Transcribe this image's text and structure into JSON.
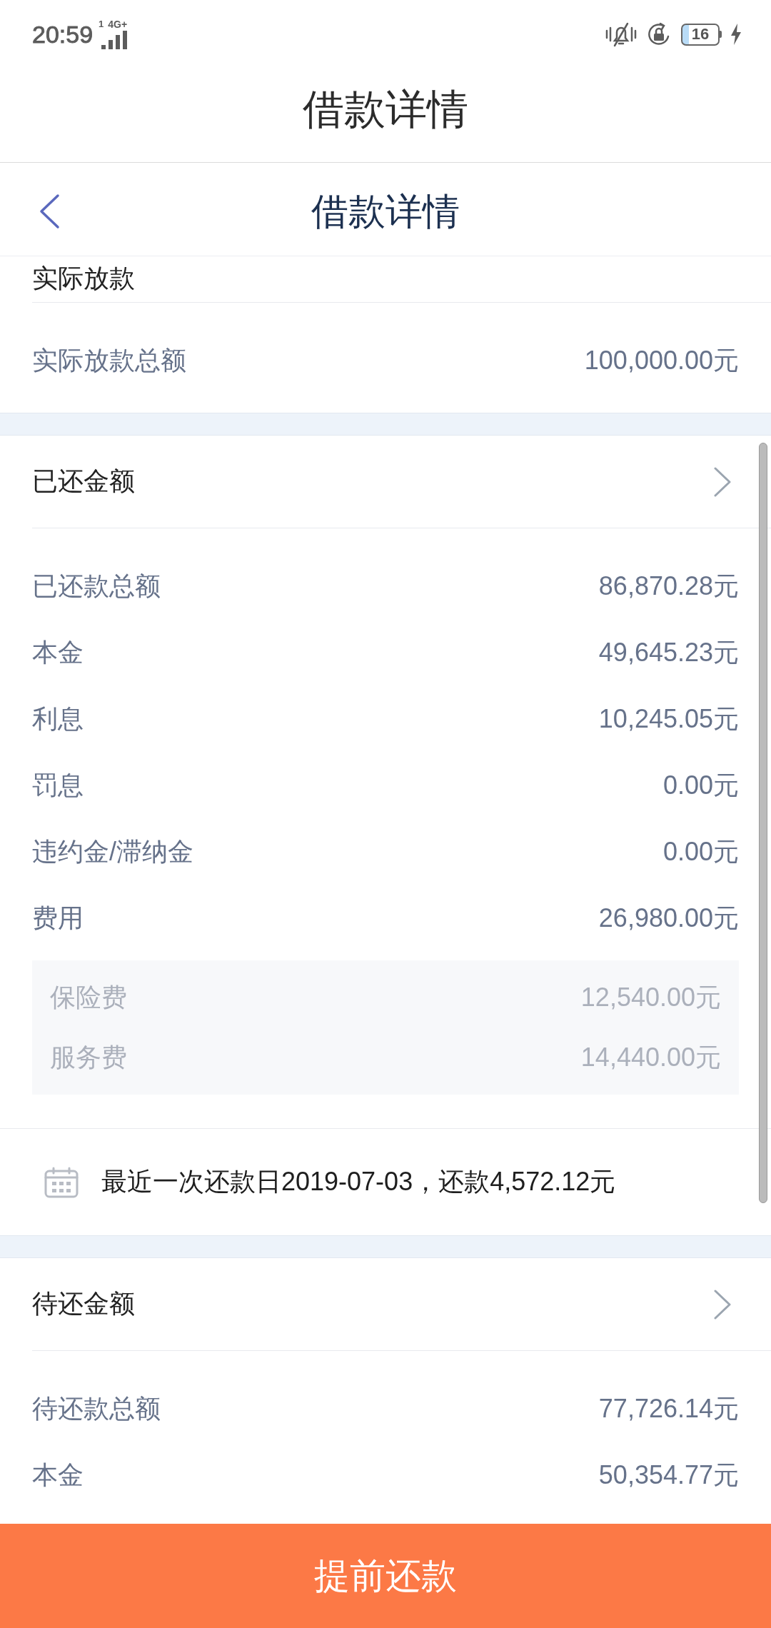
{
  "status_bar": {
    "time": "20:59",
    "sim": "1",
    "network": "4G+",
    "battery": "16"
  },
  "page_title": "借款详情",
  "nav_bar": {
    "title": "借款详情"
  },
  "sections": [
    {
      "heading": "实际放款",
      "chevron": false,
      "rows": [
        {
          "kind": "line",
          "label": "实际放款总额",
          "value": "100,000.00元"
        }
      ]
    },
    {
      "heading": "已还金额",
      "chevron": true,
      "rows": [
        {
          "kind": "line",
          "label": "已还款总额",
          "value": "86,870.28元"
        },
        {
          "kind": "line",
          "label": "本金",
          "value": "49,645.23元"
        },
        {
          "kind": "line",
          "label": "利息",
          "value": "10,245.05元"
        },
        {
          "kind": "line",
          "label": "罚息",
          "value": "0.00元"
        },
        {
          "kind": "line",
          "label": "违约金/滞纳金",
          "value": "0.00元"
        },
        {
          "kind": "line",
          "label": "费用",
          "value": "26,980.00元"
        },
        {
          "kind": "breakdown",
          "items": [
            {
              "label": "保险费",
              "value": "12,540.00元"
            },
            {
              "label": "服务费",
              "value": "14,440.00元"
            }
          ]
        }
      ],
      "note": "最近一次还款日2019-07-03，还款4,572.12元"
    },
    {
      "heading": "待还金额",
      "chevron": true,
      "rows": [
        {
          "kind": "line",
          "label": "待还款总额",
          "value": "77,726.14元"
        },
        {
          "kind": "line",
          "label": "本金",
          "value": "50,354.77元"
        }
      ]
    }
  ],
  "action_button": "提前还款"
}
